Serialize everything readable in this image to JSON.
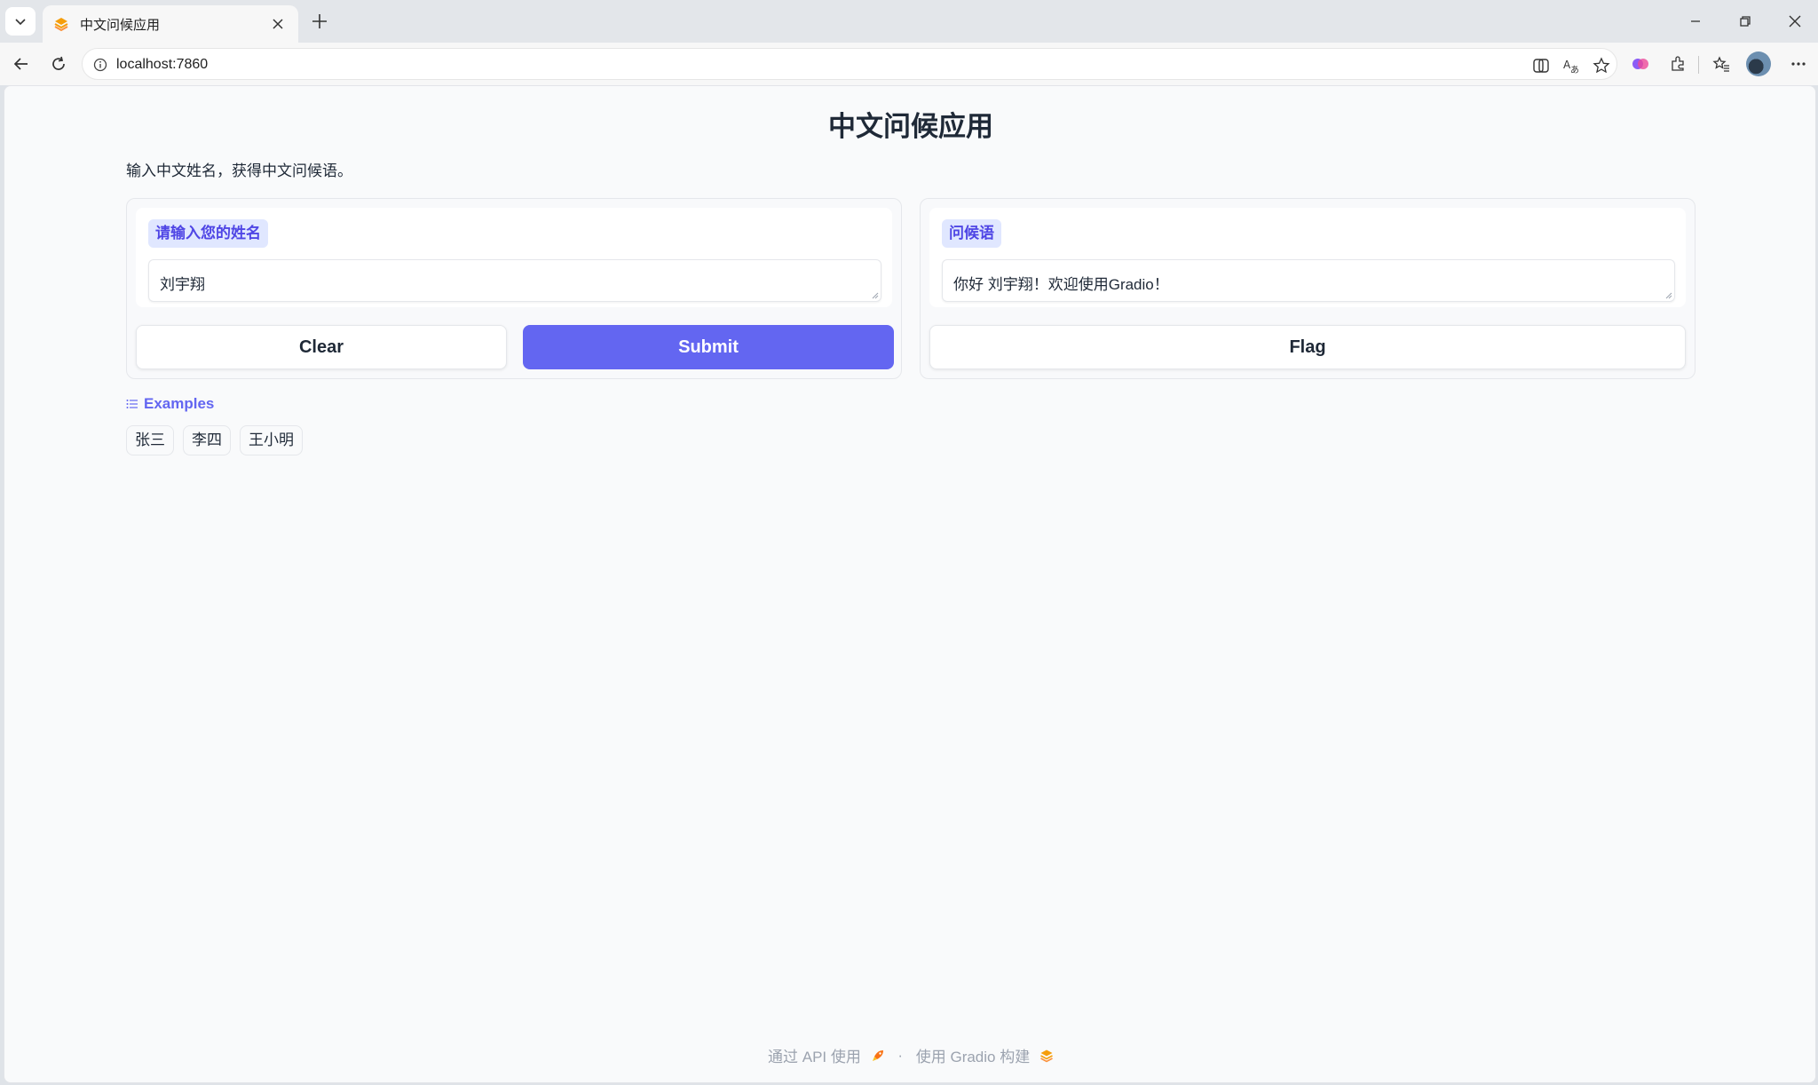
{
  "browser": {
    "tab_title": "中文问候应用",
    "url": "localhost:7860"
  },
  "app": {
    "title": "中文问候应用",
    "description": "输入中文姓名，获得中文问候语。",
    "input": {
      "label": "请输入您的姓名",
      "value": "刘宇翔"
    },
    "output": {
      "label": "问候语",
      "value": "你好 刘宇翔！欢迎使用Gradio！"
    },
    "buttons": {
      "clear": "Clear",
      "submit": "Submit",
      "flag": "Flag"
    },
    "examples": {
      "header": "Examples",
      "items": [
        "张三",
        "李四",
        "王小明"
      ]
    },
    "footer": {
      "api_text": "通过 API 使用",
      "separator": "·",
      "built_text": "使用 Gradio 构建"
    }
  },
  "colors": {
    "accent": "#6366f1",
    "label_bg": "#e0e7ff",
    "gradio_orange": "#f59e0b"
  }
}
